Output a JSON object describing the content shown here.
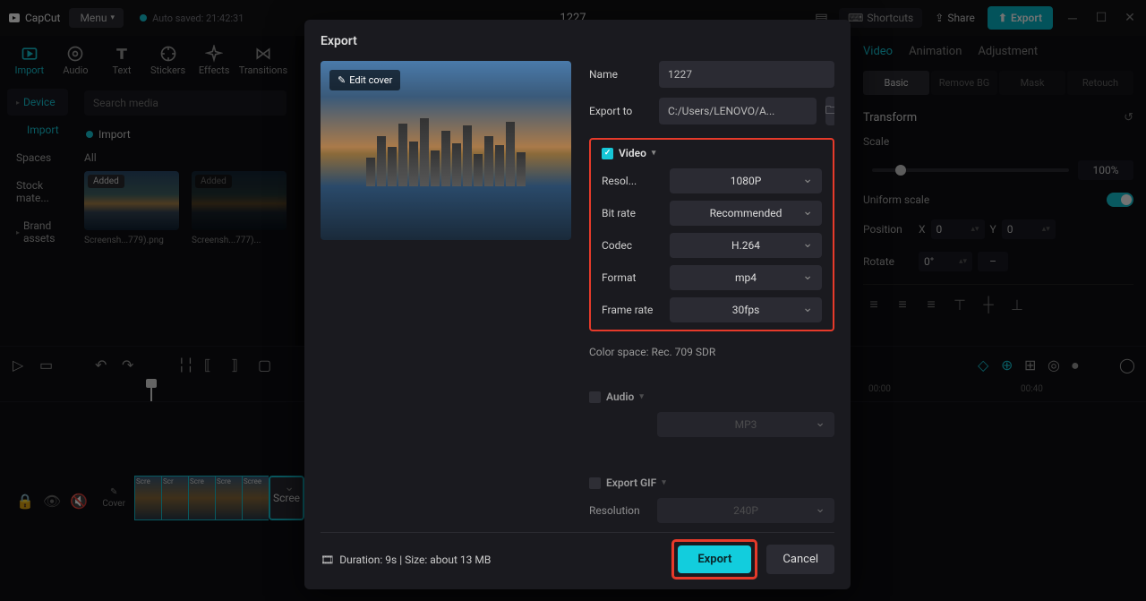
{
  "top": {
    "logo": "CapCut",
    "menu": "Menu",
    "autosave": "Auto saved: 21:42:31",
    "project": "1227",
    "shortcuts": "Shortcuts",
    "share": "Share",
    "export": "Export"
  },
  "tools": {
    "import": "Import",
    "audio": "Audio",
    "text": "Text",
    "stickers": "Stickers",
    "effects": "Effects",
    "transitions": "Transitions"
  },
  "mediaNav": {
    "device": "Device",
    "import": "Import",
    "spaces": "Spaces",
    "stock": "Stock mate...",
    "brand": "Brand assets"
  },
  "media": {
    "searchPlaceholder": "Search media",
    "importChip": "Import",
    "all": "All",
    "thumb1": {
      "badge": "Added",
      "name": "Screensh...779).png"
    },
    "thumb2": {
      "badge": "Added",
      "name": "Screensh...777)..."
    }
  },
  "inspector": {
    "tabs": {
      "video": "Video",
      "animation": "Animation",
      "adjustment": "Adjustment"
    },
    "subs": {
      "basic": "Basic",
      "remove": "Remove BG",
      "mask": "Mask",
      "retouch": "Retouch"
    },
    "transform": "Transform",
    "scale": "Scale",
    "scaleVal": "100%",
    "uniform": "Uniform scale",
    "position": "Position",
    "x": "X",
    "xv": "0",
    "y": "Y",
    "yv": "0",
    "rotate": "Rotate",
    "rv": "0°"
  },
  "timeline": {
    "r1": "00:00",
    "r2": "00:40",
    "cover": "Cover",
    "clip": "Scre"
  },
  "dialog": {
    "title": "Export",
    "editCover": "Edit cover",
    "nameLabel": "Name",
    "nameVal": "1227",
    "exportToLabel": "Export to",
    "exportToVal": "C:/Users/LENOVO/A...",
    "video": {
      "hd": "Video",
      "resolution": {
        "l": "Resol...",
        "v": "1080P"
      },
      "bitrate": {
        "l": "Bit rate",
        "v": "Recommended"
      },
      "codec": {
        "l": "Codec",
        "v": "H.264"
      },
      "format": {
        "l": "Format",
        "v": "mp4"
      },
      "framerate": {
        "l": "Frame rate",
        "v": "30fps"
      }
    },
    "colorspace": "Color space: Rec. 709 SDR",
    "audio": {
      "hd": "Audio",
      "format": {
        "l": "",
        "v": "MP3"
      }
    },
    "gif": {
      "hd": "Export GIF",
      "res": {
        "l": "Resolution",
        "v": "240P"
      }
    },
    "duration": "Duration: 9s | Size: about 13 MB",
    "exportBtn": "Export",
    "cancelBtn": "Cancel"
  }
}
